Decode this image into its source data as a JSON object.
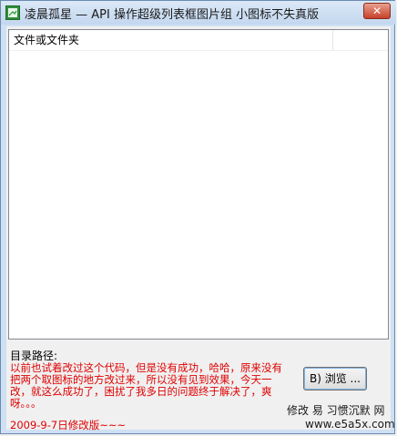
{
  "window": {
    "title": "凌晨孤星 — API 操作超级列表框图片组  小图标不失真版",
    "close_symbol": "✕"
  },
  "listview": {
    "column_header": "文件或文件夹"
  },
  "path_label": "目录路径:",
  "note": "以前也试着改过这个代码，但是没有成功，哈哈，原来没有把两个取图标的地方改过来，所以没有见到效果，今天一改，就这么成功了，困扰了我多日的问题终于解决了，爽呀。。。",
  "browse_button": "B)  浏览 ...",
  "date_note": "2009-9-7日修改版~~~",
  "watermark": {
    "line1": "修改  易  习惯沉默  网",
    "line2": "www.e5a5x.com"
  },
  "icons": {
    "app": "app-icon",
    "close": "close-icon"
  }
}
